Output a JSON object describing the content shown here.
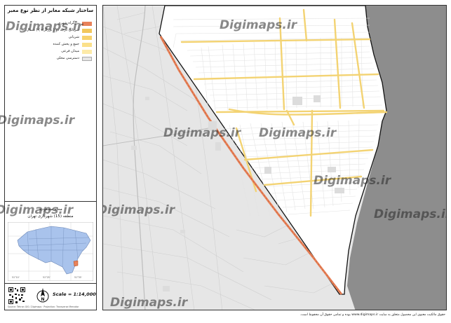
{
  "legend": {
    "title": "ساختار شبکه معابر از نظر نوع معبر",
    "items": [
      {
        "label": "بزرگراه شهری",
        "color": "#e8825a"
      },
      {
        "label": "شریانی درجه دو ( بزرگراه ) ( شمال ... )",
        "color": "#f2c75c"
      },
      {
        "label": "شریانی",
        "color": "#f7d36e"
      },
      {
        "label": "جمع و پخش کننده",
        "color": "#fbe08a"
      },
      {
        "label": "میدان فرعی",
        "color": "#fdeaa8"
      },
      {
        "label": "دسترسی محلی",
        "color": "#e6e6e6"
      }
    ]
  },
  "locator": {
    "title_line1": "محله مسعودیه",
    "title_line2": "منطقه (15) شهرداری تهران",
    "region_color": "#a9c3ec",
    "highlight_color": "#e8825a"
  },
  "footer": {
    "scale": "Scale = 1:14,000",
    "north_label": "N",
    "credit": "Source: Tehran GIS / Digimaps · Projection: Transverse Mercator"
  },
  "watermark": "Digimaps.ir",
  "bottom_note": "حقوق مالکیت معنوی این محصول متعلق به سایت www.digimaps.ir بوده و تمامی حقوق آن محفوظ است."
}
